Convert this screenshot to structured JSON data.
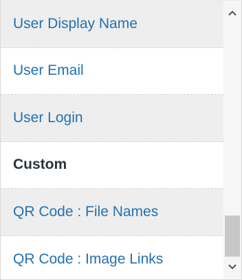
{
  "list": {
    "items": [
      {
        "label": "User Display Name"
      },
      {
        "label": "User Email"
      },
      {
        "label": "User Login"
      },
      {
        "label": "Custom"
      },
      {
        "label": "QR Code : File Names"
      },
      {
        "label": "QR Code : Image Links"
      }
    ]
  },
  "scrollbar": {
    "up_icon": "chevron-up-icon",
    "down_icon": "chevron-down-icon",
    "scroll_position": 0.95
  },
  "colors": {
    "link": "#2271b1",
    "group_heading": "#2c3338",
    "shaded_row": "#eeeeee"
  }
}
